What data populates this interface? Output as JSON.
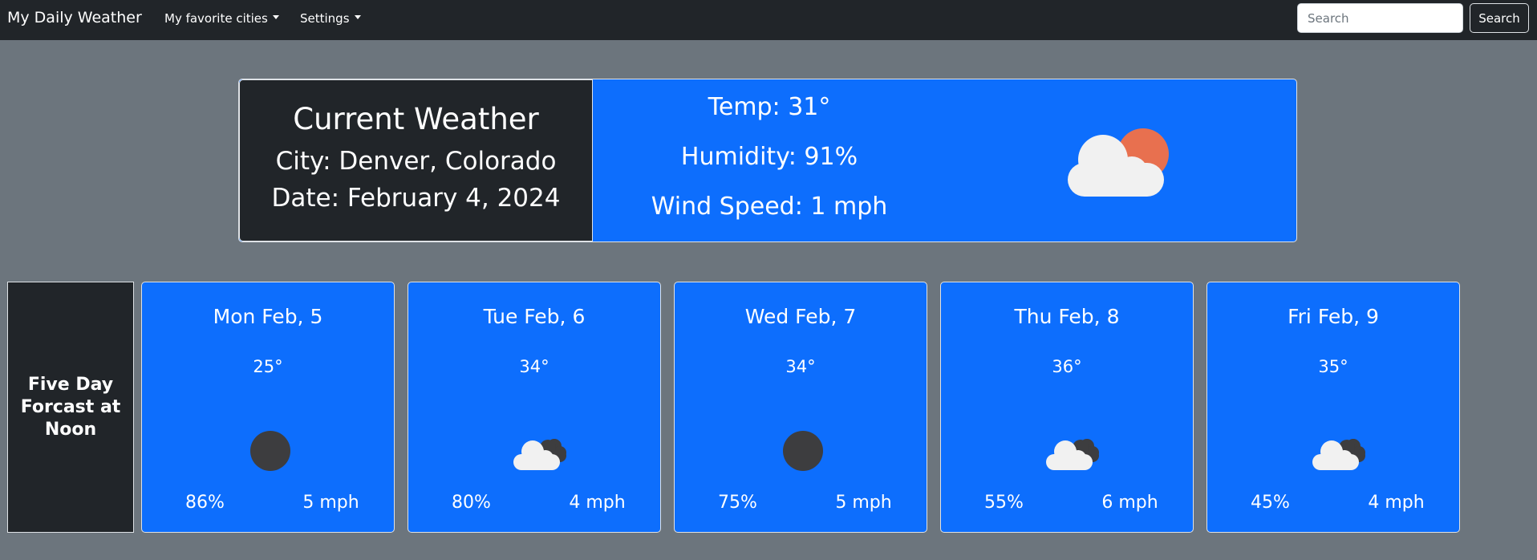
{
  "navbar": {
    "brand": "My Daily Weather",
    "links": [
      {
        "label": "My favorite cities"
      },
      {
        "label": "Settings"
      }
    ],
    "search": {
      "placeholder": "Search",
      "value": ""
    },
    "search_button": "Search"
  },
  "current": {
    "title": "Current Weather",
    "city": "City: Denver, Colorado",
    "date": "Date: February 4, 2024",
    "temp": "Temp: 31°",
    "humidity": "Humidity: 91%",
    "wind": "Wind Speed: 1 mph",
    "icon": "partly-cloudy-day-icon"
  },
  "forecast": {
    "label": "Five Day Forcast at Noon",
    "days": [
      {
        "date": "Mon Feb, 5",
        "temp": "25°",
        "icon": "dark-circle-icon",
        "humidity": "86%",
        "wind": "5 mph"
      },
      {
        "date": "Tue Feb, 6",
        "temp": "34°",
        "icon": "broken-clouds-icon",
        "humidity": "80%",
        "wind": "4 mph"
      },
      {
        "date": "Wed Feb, 7",
        "temp": "34°",
        "icon": "dark-circle-icon",
        "humidity": "75%",
        "wind": "5 mph"
      },
      {
        "date": "Thu Feb, 8",
        "temp": "36°",
        "icon": "broken-clouds-icon",
        "humidity": "55%",
        "wind": "6 mph"
      },
      {
        "date": "Fri Feb, 9",
        "temp": "35°",
        "icon": "broken-clouds-icon",
        "humidity": "45%",
        "wind": "4 mph"
      }
    ]
  },
  "colors": {
    "background": "#6c757d",
    "navbar": "#212529",
    "card": "#0d6efd",
    "sun": "#e8704f",
    "cloud": "#f1f1f1",
    "dark_cloud": "#3d3d3f"
  }
}
